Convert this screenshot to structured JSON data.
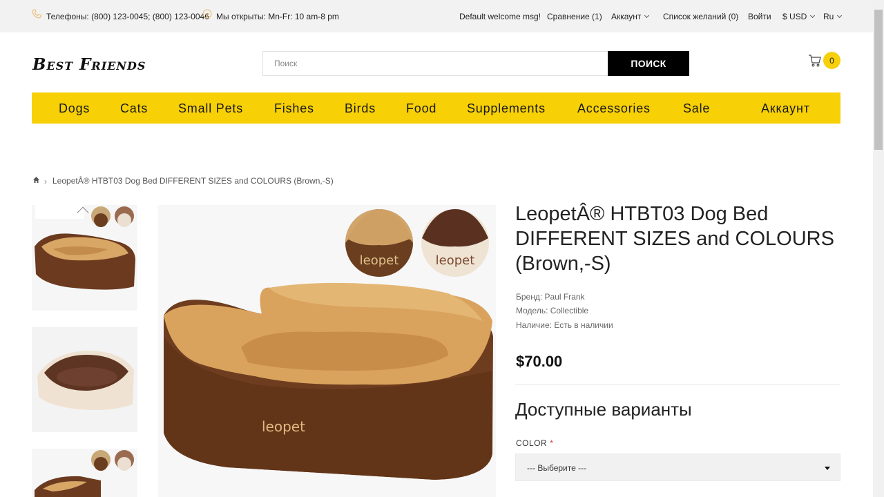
{
  "topbar": {
    "phones": "Телефоны: (800) 123-0045; (800) 123-0046",
    "hours": "Мы открыты: Mn-Fr: 10 am-8 pm",
    "welcome": "Default welcome msg!",
    "compare": "Сравнение (1)",
    "account": "Аккаунт",
    "wishlist": "Список желаний (0)",
    "login": "Войти",
    "currency": "$ USD",
    "language": "Ru",
    "accent_icon_color": "#e9b86a"
  },
  "header": {
    "logo": "Best Friends",
    "search_placeholder": "Поиск",
    "search_button": "ПОИСК",
    "cart_count": "0",
    "badge_color": "#f6d00b"
  },
  "nav": {
    "background": "#f7d006",
    "items": [
      "Dogs",
      "Cats",
      "Small Pets",
      "Fishes",
      "Birds",
      "Food",
      "Supplements",
      "Accessories",
      "Sale",
      "Аккаунт"
    ]
  },
  "breadcrumb": {
    "current": "LeopetÂ® HTBT03 Dog Bed DIFFERENT SIZES and COLOURS (Brown,-S)"
  },
  "product": {
    "title": "LeopetÂ® HTBT03 Dog Bed DIFFERENT SIZES and COLOURS (Brown,-S)",
    "brand": "Бренд: Paul Frank",
    "model": "Модель: Collectible",
    "availability": "Наличие: Есть в наличии",
    "price": "$70.00",
    "options_title": "Доступные варианты",
    "color_label": "COLOR",
    "required_mark": "*",
    "color_select": "--- Выберите ---",
    "brand_mark": "leopet"
  },
  "icons": [
    "phone-icon",
    "clock-icon",
    "cart-icon",
    "home-icon",
    "chevron-up-icon",
    "chevron-down-icon"
  ]
}
